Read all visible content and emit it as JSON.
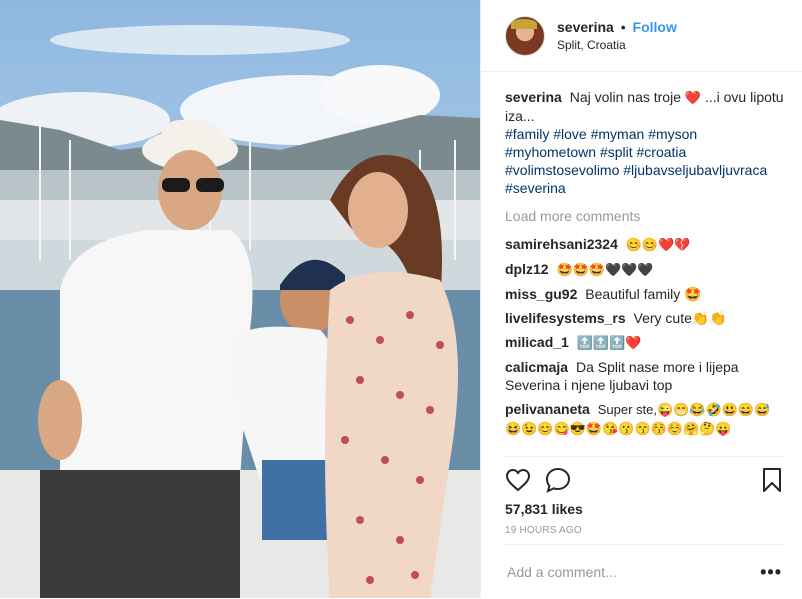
{
  "post": {
    "username": "severina",
    "follow_label": "Follow",
    "separator": "•",
    "location": "Split, Croatia"
  },
  "caption": {
    "username": "severina",
    "text_before": "Naj volin nas troje",
    "heart_emoji": "❤️",
    "text_after": "...i ovu lipotu iza...",
    "hashtags": [
      "#family",
      "#love",
      "#myman",
      "#myson",
      "#myhometown",
      "#split",
      "#croatia",
      "#volimstosevolimo",
      "#ljubavseljubavljuvraca",
      "#severina"
    ]
  },
  "load_more_label": "Load more comments",
  "comments": [
    {
      "user": "samirehsani2324",
      "text": "😊😊❤️💔"
    },
    {
      "user": "dplz12",
      "text": "🤩🤩🤩🖤🖤🖤"
    },
    {
      "user": "miss_gu92",
      "text": "Beautiful family 🤩"
    },
    {
      "user": "livelifesystems_rs",
      "text": "Very cute👏👏"
    },
    {
      "user": "milicad_1",
      "text": "🔝🔝🔝❤️"
    },
    {
      "user": "calicmaja",
      "text": "Da Split nase more i lijepa Severina i njene ljubavi top"
    },
    {
      "user": "pelivananeta",
      "text": "Super ste,😜😁😂🤣😃😄😅😆😉😊😋😎🤩😘😗😙😚☺️🤗🤔😛"
    }
  ],
  "icons": {
    "like": "heart-outline-icon",
    "comment": "speech-bubble-icon",
    "save": "bookmark-icon",
    "more": "more-options-icon"
  },
  "likes": "57,831 likes",
  "timestamp": "19 HOURS AGO",
  "add_comment_placeholder": "Add a comment...",
  "more_label": "•••",
  "colors": {
    "link_blue": "#3897f0",
    "hashtag": "#003569",
    "muted": "#999999",
    "heart_red": "#ed4956"
  }
}
